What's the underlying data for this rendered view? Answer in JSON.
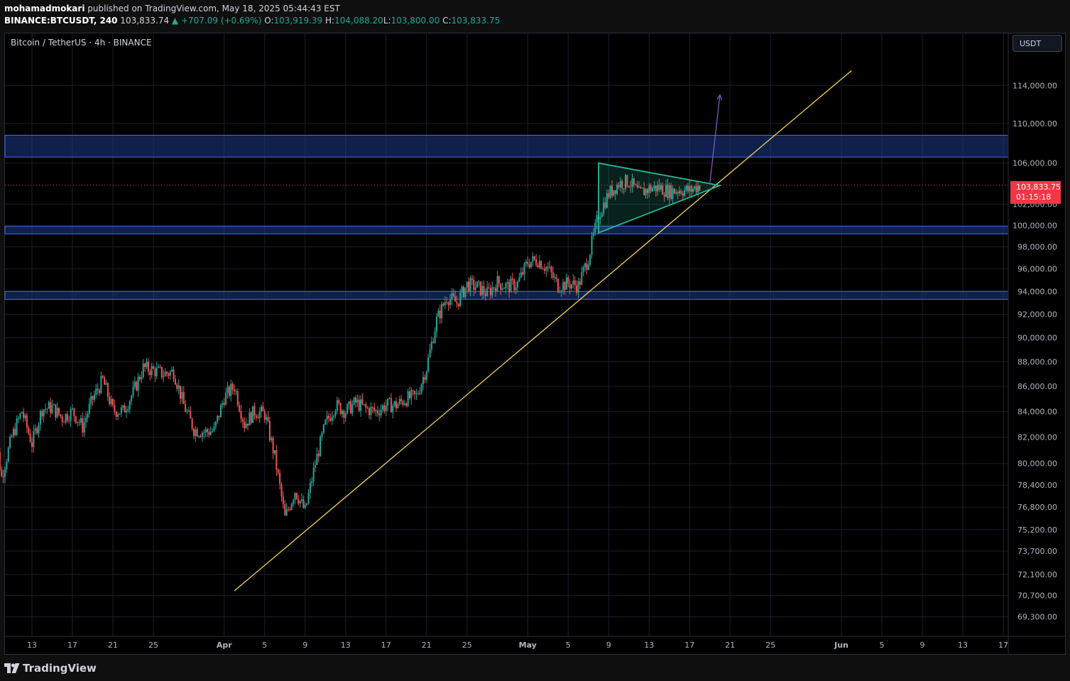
{
  "header": {
    "author": "mohamadmokari",
    "published_text": "published on TradingView.com, May 18, 2025 05:44:43 EST",
    "symbol": "BINANCE:BTCUSDT, 240",
    "last": "103,833.74",
    "change": "▲ +707.09 (+0.69%)",
    "open_label": "O:",
    "open": "103,919.39",
    "high_label": "H:",
    "high": "104,088.20",
    "low_label": "L:",
    "low": "103,800.00",
    "close_label": "C:",
    "close": "103,833.75"
  },
  "legend": "Bitcoin / TetherUS · 4h · BINANCE",
  "currency_button": "USDT",
  "price_tag": {
    "price": "103,833.75",
    "countdown": "01:15:18"
  },
  "footer": {
    "brand": "TradingView"
  },
  "colors": {
    "up": "#26a69a",
    "down": "#ef5350",
    "trendline": "#f7d358",
    "triangle": "#26b79a",
    "zone": "#1e3a8a",
    "zone_border": "#3d6df2",
    "arrow": "#7e57c2",
    "price_line": "#f23645"
  },
  "chart_data": {
    "type": "candlestick",
    "title": "Bitcoin / TetherUS · 4h · BINANCE",
    "y_scale": "log",
    "y_ticks": [
      114000,
      110000,
      106000,
      102000,
      100000,
      98000,
      96000,
      94000,
      92000,
      90000,
      88000,
      86000,
      84000,
      82000,
      80000,
      78400,
      76800,
      75200,
      73700,
      72100,
      70700,
      69300
    ],
    "y_tick_labels": [
      "114,000.00",
      "110,000.00",
      "106,000.00",
      "102,000.00",
      "100,000.00",
      "98,000.00",
      "96,000.00",
      "94,000.00",
      "92,000.00",
      "90,000.00",
      "88,000.00",
      "86,000.00",
      "84,000.00",
      "82,000.00",
      "80,000.00",
      "78,400.00",
      "76,800.00",
      "75,200.00",
      "73,700.00",
      "72,100.00",
      "70,700.00",
      "69,300.00"
    ],
    "x_tick_labels": [
      "13",
      "17",
      "21",
      "25",
      "Apr",
      "5",
      "9",
      "13",
      "17",
      "21",
      "25",
      "May",
      "5",
      "9",
      "13",
      "17",
      "21",
      "25",
      "Jun",
      "5",
      "9",
      "13",
      "17"
    ],
    "x_tick_dates": [
      "2025-03-13",
      "2025-03-17",
      "2025-03-21",
      "2025-03-25",
      "2025-04-01",
      "2025-04-05",
      "2025-04-09",
      "2025-04-13",
      "2025-04-17",
      "2025-04-21",
      "2025-04-25",
      "2025-05-01",
      "2025-05-05",
      "2025-05-09",
      "2025-05-13",
      "2025-05-17",
      "2025-05-21",
      "2025-05-25",
      "2025-06-01",
      "2025-06-05",
      "2025-06-09",
      "2025-06-13",
      "2025-06-17"
    ],
    "last_price": 103833.75,
    "zones": [
      {
        "from": 106600,
        "to": 108800
      },
      {
        "from": 99200,
        "to": 99900
      },
      {
        "from": 93300,
        "to": 94000
      }
    ],
    "trendline": [
      [
        "2025-04-02",
        71000
      ],
      [
        "2025-06-02",
        115600
      ]
    ],
    "triangle": [
      [
        "2025-05-08",
        106000
      ],
      [
        "2025-05-20",
        103800
      ],
      [
        "2025-05-08",
        99300
      ]
    ],
    "breakout_arrow": [
      [
        "2025-05-19",
        104000
      ],
      [
        "2025-05-20",
        113000
      ]
    ],
    "close_path": [
      [
        "2025-03-09",
        84000
      ],
      [
        "2025-03-10",
        79000
      ],
      [
        "2025-03-11",
        82000
      ],
      [
        "2025-03-12",
        84000
      ],
      [
        "2025-03-13",
        81500
      ],
      [
        "2025-03-14",
        84200
      ],
      [
        "2025-03-15",
        84300
      ],
      [
        "2025-03-16",
        83500
      ],
      [
        "2025-03-17",
        84000
      ],
      [
        "2025-03-18",
        82800
      ],
      [
        "2025-03-19",
        85000
      ],
      [
        "2025-03-20",
        86500
      ],
      [
        "2025-03-21",
        84100
      ],
      [
        "2025-03-22",
        84000
      ],
      [
        "2025-03-23",
        85500
      ],
      [
        "2025-03-24",
        87500
      ],
      [
        "2025-03-25",
        87300
      ],
      [
        "2025-03-26",
        87000
      ],
      [
        "2025-03-27",
        87200
      ],
      [
        "2025-03-28",
        84500
      ],
      [
        "2025-03-29",
        82600
      ],
      [
        "2025-03-30",
        82400
      ],
      [
        "2025-03-31",
        82500
      ],
      [
        "2025-04-01",
        85100
      ],
      [
        "2025-04-02",
        86000
      ],
      [
        "2025-04-03",
        83000
      ],
      [
        "2025-04-04",
        84000
      ],
      [
        "2025-04-05",
        83800
      ],
      [
        "2025-04-06",
        80500
      ],
      [
        "2025-04-07",
        76000
      ],
      [
        "2025-04-08",
        78000
      ],
      [
        "2025-04-09",
        76500
      ],
      [
        "2025-04-10",
        80000
      ],
      [
        "2025-04-11",
        83000
      ],
      [
        "2025-04-12",
        84500
      ],
      [
        "2025-04-13",
        84000
      ],
      [
        "2025-04-14",
        84700
      ],
      [
        "2025-04-15",
        84200
      ],
      [
        "2025-04-16",
        84000
      ],
      [
        "2025-04-17",
        84500
      ],
      [
        "2025-04-18",
        84500
      ],
      [
        "2025-04-19",
        85000
      ],
      [
        "2025-04-20",
        85200
      ],
      [
        "2025-04-21",
        87500
      ],
      [
        "2025-04-22",
        91500
      ],
      [
        "2025-04-23",
        93500
      ],
      [
        "2025-04-24",
        93000
      ],
      [
        "2025-04-25",
        94600
      ],
      [
        "2025-04-26",
        94400
      ],
      [
        "2025-04-27",
        93800
      ],
      [
        "2025-04-28",
        94800
      ],
      [
        "2025-04-29",
        94400
      ],
      [
        "2025-04-30",
        94700
      ],
      [
        "2025-05-01",
        96600
      ],
      [
        "2025-05-02",
        96800
      ],
      [
        "2025-05-03",
        96000
      ],
      [
        "2025-05-04",
        94500
      ],
      [
        "2025-05-05",
        94700
      ],
      [
        "2025-05-06",
        94500
      ],
      [
        "2025-05-07",
        97000
      ],
      [
        "2025-05-08",
        101000
      ],
      [
        "2025-05-09",
        103000
      ],
      [
        "2025-05-10",
        104000
      ],
      [
        "2025-05-11",
        104200
      ],
      [
        "2025-05-12",
        103000
      ],
      [
        "2025-05-13",
        103500
      ],
      [
        "2025-05-14",
        103600
      ],
      [
        "2025-05-15",
        103200
      ],
      [
        "2025-05-16",
        103400
      ],
      [
        "2025-05-17",
        103300
      ],
      [
        "2025-05-18",
        103833
      ]
    ]
  }
}
